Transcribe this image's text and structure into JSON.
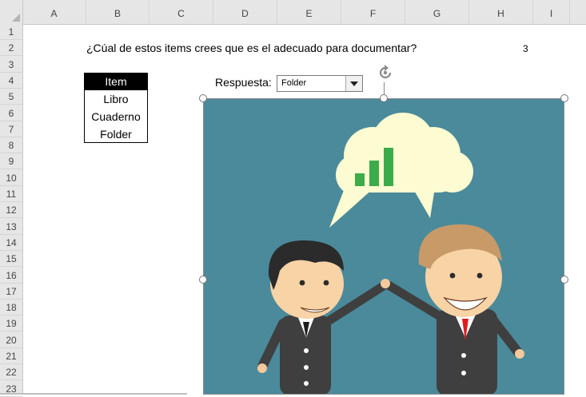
{
  "columns": [
    "A",
    "B",
    "C",
    "D",
    "E",
    "F",
    "G",
    "H",
    "I"
  ],
  "rows": [
    "1",
    "2",
    "3",
    "4",
    "5",
    "6",
    "7",
    "8",
    "9",
    "10",
    "11",
    "12",
    "13",
    "14",
    "15",
    "16",
    "17",
    "18",
    "19",
    "20",
    "21",
    "22",
    "23"
  ],
  "sheet": {
    "question": "¿Cúal de estos items crees que es el adecuado para documentar?",
    "count": "3",
    "item_table": {
      "header": "Item",
      "items": [
        "Libro",
        "Cuaderno",
        "Folder"
      ]
    },
    "answer": {
      "label": "Respuesta:",
      "selected": "Folder"
    }
  },
  "picture": {
    "background_color": "#4a8a9b",
    "bubble_color": "#fdfbd1",
    "bar_color": "#3cab4a",
    "chart_values": [
      1,
      2,
      3
    ]
  }
}
